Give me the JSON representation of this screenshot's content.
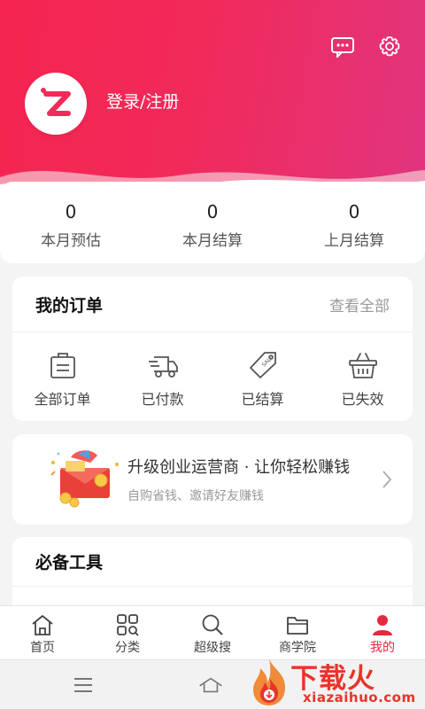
{
  "header": {
    "login_label": "登录/注册",
    "logo_letter": "Z",
    "message_icon": "chat-dots-icon",
    "settings_icon": "gear-icon",
    "gradient_start": "#f5254f",
    "gradient_end": "#e1357f"
  },
  "stats": [
    {
      "value": "0",
      "label": "本月预估"
    },
    {
      "value": "0",
      "label": "本月结算"
    },
    {
      "value": "0",
      "label": "上月结算"
    }
  ],
  "orders": {
    "title": "我的订单",
    "view_all": "查看全部",
    "items": [
      {
        "label": "全部订单",
        "icon": "clipboard-icon"
      },
      {
        "label": "已付款",
        "icon": "delivery-truck-icon"
      },
      {
        "label": "已结算",
        "icon": "sale-tag-icon"
      },
      {
        "label": "已失效",
        "icon": "basket-icon"
      }
    ]
  },
  "promo": {
    "title": "升级创业运营商 · 让你轻松赚钱",
    "subtitle": "自购省钱、邀请好友赚钱"
  },
  "tools": {
    "title": "必备工具"
  },
  "tabbar": {
    "active_color": "#e6283f",
    "items": [
      {
        "label": "首页",
        "icon": "home-icon"
      },
      {
        "label": "分类",
        "icon": "grid-icon"
      },
      {
        "label": "超级搜",
        "icon": "search-icon"
      },
      {
        "label": "商学院",
        "icon": "folder-icon"
      },
      {
        "label": "我的",
        "icon": "user-icon"
      }
    ]
  },
  "watermark": {
    "cn": "下载火",
    "en": "xiazaihuo.com"
  }
}
